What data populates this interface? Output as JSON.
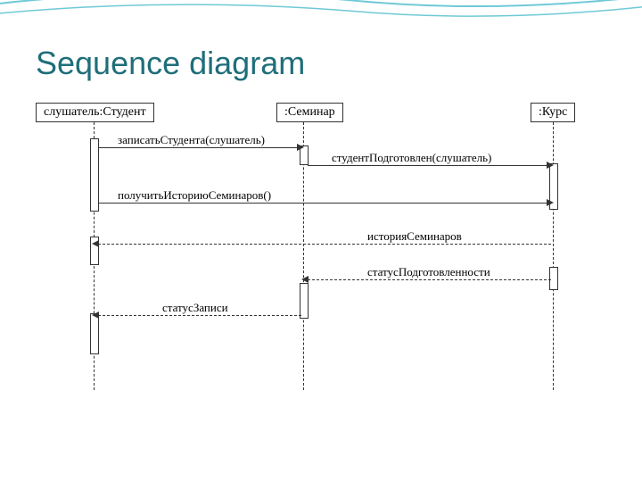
{
  "title": "Sequence diagram",
  "actors": {
    "student": "слушатель:Студент",
    "seminar": ":Семинар",
    "course": ":Курс"
  },
  "messages": {
    "m1": "записатьСтудента(слушатель)",
    "m2": "студентПодготовлен(слушатель)",
    "m3": "получитьИсториюСеминаров()",
    "r1": "историяСеминаров",
    "r2": "статусПодготовленности",
    "r3": "статусЗаписи"
  },
  "chart_data": {
    "type": "table",
    "diagram_type": "UML sequence diagram",
    "lifelines": [
      {
        "id": "student",
        "label": "слушатель:Студент"
      },
      {
        "id": "seminar",
        "label": ":Семинар"
      },
      {
        "id": "course",
        "label": ":Курс"
      }
    ],
    "interactions": [
      {
        "from": "student",
        "to": "seminar",
        "label": "записатьСтудента(слушатель)",
        "kind": "call"
      },
      {
        "from": "seminar",
        "to": "course",
        "label": "студентПодготовлен(слушатель)",
        "kind": "call"
      },
      {
        "from": "student",
        "to": "course",
        "label": "получитьИсториюСеминаров()",
        "kind": "call"
      },
      {
        "from": "course",
        "to": "student",
        "label": "историяСеминаров",
        "kind": "return"
      },
      {
        "from": "course",
        "to": "seminar",
        "label": "статусПодготовленности",
        "kind": "return"
      },
      {
        "from": "seminar",
        "to": "student",
        "label": "статусЗаписи",
        "kind": "return"
      }
    ]
  }
}
